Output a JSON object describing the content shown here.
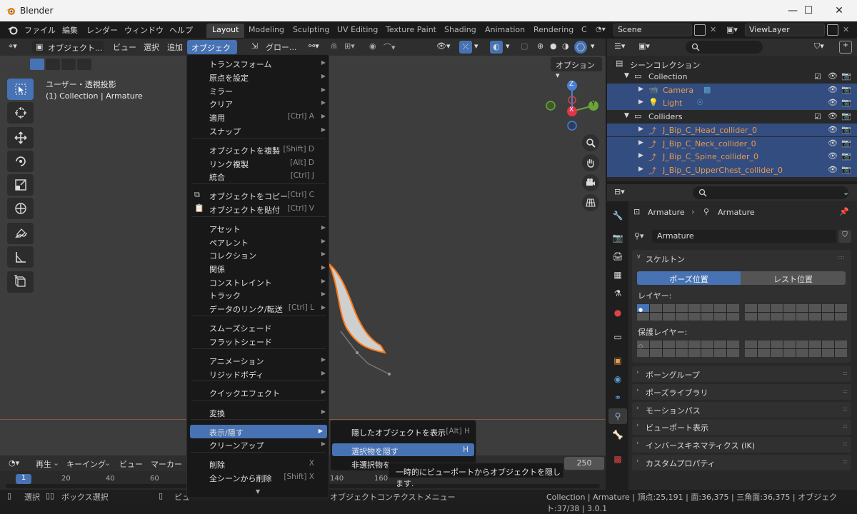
{
  "window": {
    "title": "Blender"
  },
  "menubar": {
    "items": [
      "ファイル",
      "編集",
      "レンダー",
      "ウィンドウ",
      "ヘルプ"
    ]
  },
  "workspaces": [
    "Layout",
    "Modeling",
    "Sculpting",
    "UV Editing",
    "Texture Paint",
    "Shading",
    "Animation",
    "Rendering",
    "C"
  ],
  "scene": {
    "name": "Scene",
    "view_layer": "ViewLayer"
  },
  "viewport_header": {
    "mode": "オブジェクト...",
    "view": "ビュー",
    "select": "選択",
    "add": "追加",
    "object": "オブジェクト",
    "transform_orientation": "グロー...",
    "options": "オプション"
  },
  "viewport_info": {
    "line1": "ユーザー・透視投影",
    "line2": "(1) Collection | Armature"
  },
  "gizmo": {
    "z": "Z",
    "y": "Y",
    "x": "X"
  },
  "context_menu": {
    "items": [
      {
        "label": "トランスフォーム",
        "shortcut": "",
        "sub": true
      },
      {
        "label": "原点を設定",
        "shortcut": "",
        "sub": true
      },
      {
        "label": "ミラー",
        "shortcut": "",
        "sub": true
      },
      {
        "label": "クリア",
        "shortcut": "",
        "sub": true
      },
      {
        "label": "適用",
        "shortcut": "[Ctrl] A",
        "sub": true
      },
      {
        "label": "スナップ",
        "shortcut": "",
        "sub": true
      },
      {
        "label": "オブジェクトを複製",
        "shortcut": "[Shift] D",
        "sub": false
      },
      {
        "label": "リンク複製",
        "shortcut": "[Alt] D",
        "sub": false
      },
      {
        "label": "統合",
        "shortcut": "[Ctrl] J",
        "sub": false
      },
      {
        "label": "オブジェクトをコピー",
        "shortcut": "[Ctrl] C",
        "sub": false
      },
      {
        "label": "オブジェクトを貼付",
        "shortcut": "[Ctrl] V",
        "sub": false
      },
      {
        "label": "アセット",
        "shortcut": "",
        "sub": true
      },
      {
        "label": "ペアレント",
        "shortcut": "",
        "sub": true
      },
      {
        "label": "コレクション",
        "shortcut": "",
        "sub": true
      },
      {
        "label": "関係",
        "shortcut": "",
        "sub": true
      },
      {
        "label": "コンストレイント",
        "shortcut": "",
        "sub": true
      },
      {
        "label": "トラック",
        "shortcut": "",
        "sub": true
      },
      {
        "label": "データのリンク/転送",
        "shortcut": "[Ctrl] L",
        "sub": true
      },
      {
        "label": "スムーズシェード",
        "shortcut": "",
        "sub": false
      },
      {
        "label": "フラットシェード",
        "shortcut": "",
        "sub": false
      },
      {
        "label": "アニメーション",
        "shortcut": "",
        "sub": true
      },
      {
        "label": "リジッドボディ",
        "shortcut": "",
        "sub": true
      },
      {
        "label": "クイックエフェクト",
        "shortcut": "",
        "sub": true
      },
      {
        "label": "変換",
        "shortcut": "",
        "sub": true
      },
      {
        "label": "表示/隠す",
        "shortcut": "",
        "sub": true
      },
      {
        "label": "クリーンアップ",
        "shortcut": "",
        "sub": true
      },
      {
        "label": "削除",
        "shortcut": "X",
        "sub": false
      },
      {
        "label": "全シーンから削除",
        "shortcut": "[Shift] X",
        "sub": false
      }
    ]
  },
  "submenu": {
    "items": [
      {
        "label": "隠したオブジェクトを表示",
        "shortcut": "[Alt] H"
      },
      {
        "label": "選択物を隠す",
        "shortcut": "H"
      },
      {
        "label": "非選択物を",
        "shortcut": ""
      }
    ]
  },
  "tooltip": "一時的にビューポートからオブジェクトを隠します.",
  "outliner": {
    "header": "シーンコレクション",
    "rows": [
      {
        "label": "Collection",
        "indent": 1,
        "type": "collection",
        "sel": false
      },
      {
        "label": "Camera",
        "indent": 2,
        "type": "camera",
        "sel": true
      },
      {
        "label": "Light",
        "indent": 2,
        "type": "light",
        "sel": true
      },
      {
        "label": "Colliders",
        "indent": 1,
        "type": "collection",
        "sel": false
      },
      {
        "label": "J_Bip_C_Head_collider_0",
        "indent": 2,
        "type": "empty",
        "sel": true
      },
      {
        "label": "J_Bip_C_Neck_collider_0",
        "indent": 2,
        "type": "empty",
        "sel": true
      },
      {
        "label": "J_Bip_C_Spine_collider_0",
        "indent": 2,
        "type": "empty",
        "sel": true
      },
      {
        "label": "J_Bip_C_UpperChest_collider_0",
        "indent": 2,
        "type": "empty",
        "sel": true
      }
    ]
  },
  "properties": {
    "breadcrumb_obj": "Armature",
    "breadcrumb_data": "Armature",
    "data_name": "Armature",
    "skeleton_panel": "スケルトン",
    "pose_position": "ポーズ位置",
    "rest_position": "レスト位置",
    "layers_label": "レイヤー:",
    "protected_label": "保護レイヤー:",
    "panels": [
      "ボーングループ",
      "ポーズライブラリ",
      "モーションパス",
      "ビューポート表示",
      "インバースキネマティクス (IK)",
      "カスタムプロパティ"
    ]
  },
  "timeline": {
    "playback": "再生",
    "keying": "キーイング",
    "view": "ビュー",
    "marker": "マーカー",
    "current_frame": "1",
    "end_frame": "250",
    "ticks": [
      "20",
      "40",
      "60",
      "140",
      "160"
    ]
  },
  "statusbar": {
    "left1": "選択",
    "left2": "ボックス選択",
    "left3": "ビュ",
    "mid": "オブジェクトコンテクストメニュー",
    "right": "Collection | Armature | 頂点:25,191 | 面:36,375 | 三角面:36,375 | オブジェクト:37/38 | 3.0.1"
  },
  "colors": {
    "accent": "#4772b3",
    "selected_row": "#334d80",
    "orange": "#e99a4a"
  }
}
